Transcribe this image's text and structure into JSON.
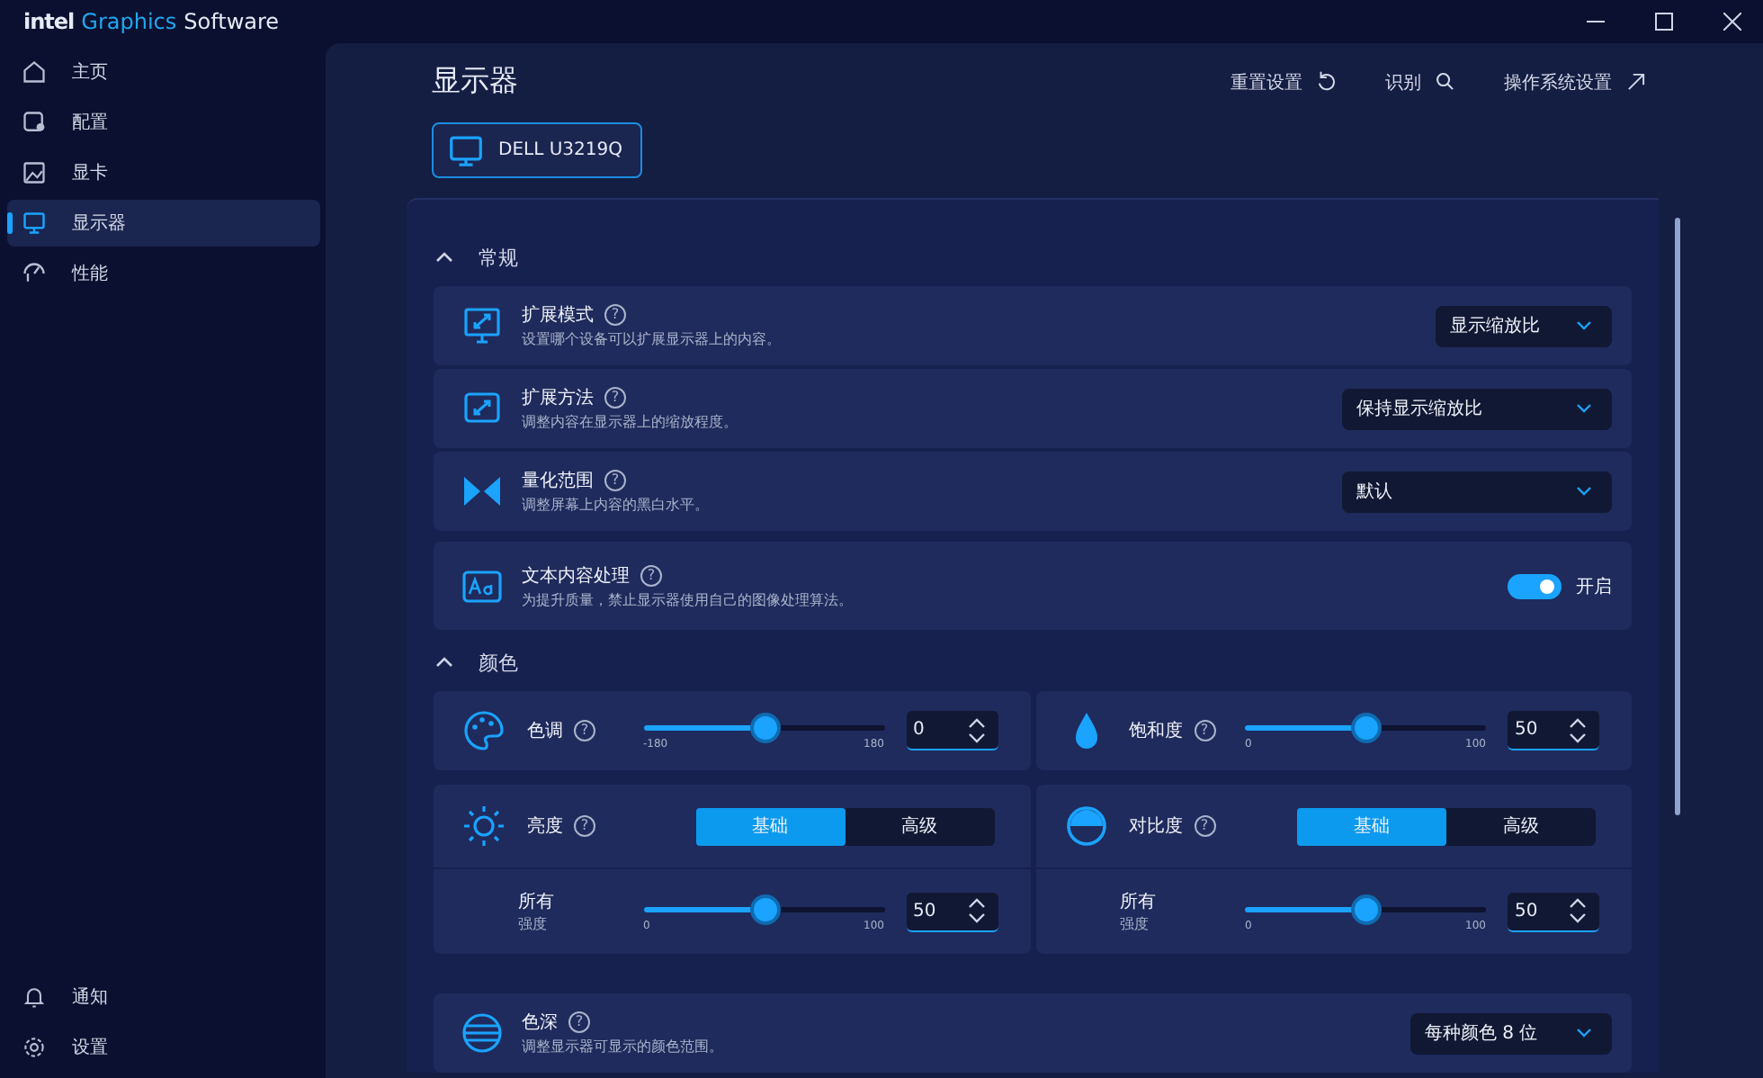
{
  "window": {
    "brand": [
      "intel",
      "Graphics",
      "Software"
    ]
  },
  "sidebar": {
    "items": [
      {
        "label": "主页",
        "selected": false
      },
      {
        "label": "配置",
        "selected": false
      },
      {
        "label": "显卡",
        "selected": false
      },
      {
        "label": "显示器",
        "selected": true
      },
      {
        "label": "性能",
        "selected": false
      }
    ],
    "footer": [
      {
        "label": "通知"
      },
      {
        "label": "设置"
      }
    ]
  },
  "page": {
    "title": "显示器",
    "actions": [
      {
        "label": "重置设置"
      },
      {
        "label": "识别"
      },
      {
        "label": "操作系统设置"
      }
    ],
    "monitors": [
      {
        "label": "DELL U3219Q",
        "selected": true
      }
    ]
  },
  "general": {
    "title": "常规",
    "expanded": true,
    "rows": [
      {
        "kind": "dropdown",
        "title": "扩展模式",
        "help": "?",
        "desc": "设置哪个设备可以扩展显示器上的内容。",
        "value": "显示缩放比"
      },
      {
        "kind": "dropdown",
        "title": "扩展方法",
        "help": "?",
        "desc": "调整内容在显示器上的缩放程度。",
        "value": "保持显示缩放比"
      },
      {
        "kind": "dropdown",
        "title": "量化范围",
        "help": "?",
        "desc": "调整屏幕上内容的黑白水平。",
        "value": "默认"
      },
      {
        "kind": "toggle",
        "title": "文本内容处理",
        "help": "?",
        "desc": "为提升质量，禁止显示器使用自己的图像处理算法。",
        "on": true,
        "state_label": "开启"
      }
    ]
  },
  "color": {
    "title": "颜色",
    "expanded": true,
    "tiles": [
      {
        "kind": "slider",
        "title": "色调",
        "help": "?",
        "min": "-180",
        "max": "180",
        "value": "0",
        "level": 0.5
      },
      {
        "kind": "slider",
        "title": "饱和度",
        "help": "?",
        "min": "0",
        "max": "100",
        "value": "50",
        "level": 0.5
      },
      {
        "kind": "segmented",
        "title": "亮度",
        "help": "?",
        "options": [
          {
            "label": "基础",
            "selected": true
          },
          {
            "label": "高级",
            "selected": false
          }
        ],
        "sub": {
          "label": "所有",
          "sublabel": "强度",
          "min": "0",
          "max": "100",
          "value": "50",
          "level": 0.5
        }
      },
      {
        "kind": "segmented",
        "title": "对比度",
        "help": "?",
        "options": [
          {
            "label": "基础",
            "selected": true
          },
          {
            "label": "高级",
            "selected": false
          }
        ],
        "sub": {
          "label": "所有",
          "sublabel": "强度",
          "min": "0",
          "max": "100",
          "value": "50",
          "level": 0.5
        }
      }
    ],
    "rows": [
      {
        "kind": "dropdown",
        "title": "色深",
        "help": "?",
        "desc": "调整显示器可显示的颜色范围。",
        "value": "每种颜色 8 位"
      }
    ]
  }
}
